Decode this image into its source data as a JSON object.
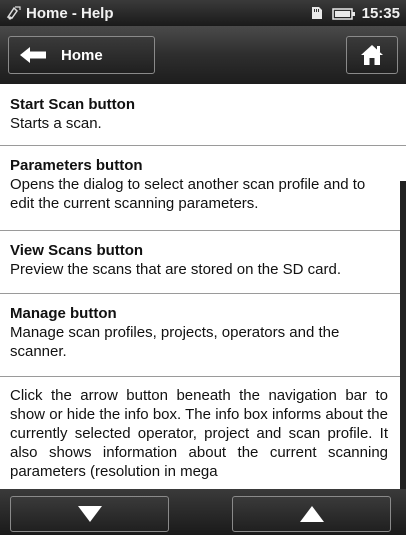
{
  "status_bar": {
    "title": "Home - Help",
    "time": "15:35",
    "icons": [
      "scanner-app-icon",
      "sd-card-icon",
      "battery-icon"
    ]
  },
  "nav_bar": {
    "back_label": "Home",
    "icons": [
      "back-arrow-icon",
      "home-icon"
    ]
  },
  "sections": [
    {
      "title": "Start Scan button",
      "text": "Starts a scan."
    },
    {
      "title": "Parameters button",
      "text": "Opens the dialog to select another scan profile and to edit the current scanning parameters."
    },
    {
      "title": "View Scans button",
      "text": "Preview the scans that are stored on the SD card."
    },
    {
      "title": "Manage button",
      "text": "Manage scan profiles, projects, operators and the scanner."
    },
    {
      "title": "",
      "text": "Click the arrow button beneath the navigation bar to show or hide the info box. The info box informs about the currently selected operator, project and scan profile. It also shows information about the current scanning parameters (resolution in mega"
    }
  ],
  "bottom_bar": {
    "icons": [
      "scroll-down-icon",
      "scroll-up-icon"
    ]
  },
  "colors": {
    "bar_dark": "#1a1a1a",
    "content_bg": "#ffffff",
    "divider": "#9a9a9a"
  }
}
